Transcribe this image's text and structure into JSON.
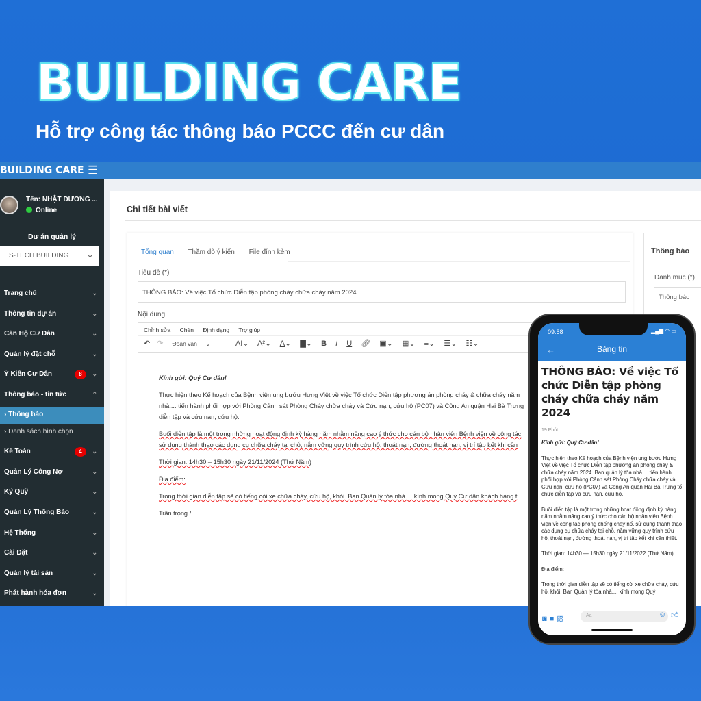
{
  "hero": {
    "title": "BUILDING CARE",
    "subtitle": "Hỗ trợ công tác thông báo PCCC đến cư dân"
  },
  "colors": {
    "background": "#1f6fd6",
    "topbar": "#2f7fcd",
    "sidebar": "#222d32",
    "active": "#3c8dbc",
    "badge": "#e60000"
  },
  "app": {
    "brand": "BUILDING CARE",
    "menu_icon": "hamburger-icon"
  },
  "user": {
    "name": "Tên: NHẬT DƯƠNG ...",
    "status": "Online"
  },
  "project": {
    "label": "Dự án quản lý",
    "selected": "S-TECH BUILDING"
  },
  "sidebar": {
    "items": [
      {
        "label": "Trang chủ"
      },
      {
        "label": "Thông tin dự án"
      },
      {
        "label": "Căn Hộ Cư Dân"
      },
      {
        "label": "Quản lý đặt chỗ"
      },
      {
        "label": "Ý Kiến Cư Dân",
        "badge": "8"
      },
      {
        "label": "Thông báo - tin tức"
      },
      {
        "label": "Thông báo"
      },
      {
        "label": "Danh sách bình chọn"
      },
      {
        "label": "Kế Toán",
        "badge": "4"
      },
      {
        "label": "Quản Lý Công Nợ"
      },
      {
        "label": "Ký Quỹ"
      },
      {
        "label": "Quản Lý Thông Báo"
      },
      {
        "label": "Hệ Thống"
      },
      {
        "label": "Cài Đặt"
      },
      {
        "label": "Quản lý tài sản"
      },
      {
        "label": "Phát hành hóa đơn"
      }
    ]
  },
  "main": {
    "title": "Chi tiết bài viết",
    "tabs": [
      "Tổng quan",
      "Thăm dò ý kiến",
      "File đính kèm"
    ],
    "title_label": "Tiêu đề (*)",
    "title_value": "THÔNG BÁO: Về việc Tổ chức Diễn tập phòng cháy chữa cháy năm 2024",
    "content_label": "Nội dung",
    "editor_menu": [
      "Chỉnh sửa",
      "Chèn",
      "Định dạng",
      "Trợ giúp"
    ],
    "paragraph_style": "Đoạn văn",
    "content": [
      "Kính gửi: Quý Cư dân!",
      "Thực hiện theo Kế hoạch của Bệnh viện ung bướu Hưng Việt về việc Tổ chức Diễn tập phương án phòng cháy & chữa cháy năm",
      "nhà.... tiến hành phối hợp với Phòng Cảnh sát Phòng Cháy chữa cháy và Cứu nạn, cứu hộ (PC07) và Công An quận Hai Bà Trưng",
      "diễn tập và cứu nạn, cứu hộ.",
      "Buổi diễn tập là một trong những hoạt động định kỳ hàng năm nhằm nâng cao ý thức cho cán bộ nhân viên Bệnh viện về công tác",
      "sử dụng thành thạo các dụng cụ chữa cháy tại chỗ, nắm vững quy trình cứu hộ, thoát nạn, đường thoát nạn, vị trí tập kết khi cần",
      "Thời gian: 14h30 – 15h30 ngày 21/11/2024 (Thứ Năm)",
      "Địa điểm:",
      "Trong thời gian diễn tập sẽ có tiếng còi xe chữa cháy, cứu hộ, khói. Ban Quản lý tòa nhà.... kính mong Quý Cư dân khách hàng t",
      "Trân trọng./."
    ]
  },
  "right_panel": {
    "title": "Thông báo",
    "category_label": "Danh mục (*)",
    "category_value": "Thông báo"
  },
  "phone": {
    "time": "09:58",
    "header": "Bảng tin",
    "title": "THÔNG BÁO: Về việc Tổ chức Diễn tập phòng cháy chữa cháy năm 2024",
    "meta": "19 Phút",
    "greeting": "Kính gửi: Quý Cư dân!",
    "p1": "Thực hiện theo Kế hoạch của Bệnh viện ung bướu Hưng Việt về việc Tổ chức Diễn tập phương án phòng cháy & chữa cháy năm 2024. Ban quản lý tòa nhà.... tiến hành phối hợp với Phòng Cảnh sát Phòng Cháy chữa cháy và Cứu nạn, cứu hộ (PC07) và Công An quận Hai Bà Trưng tổ chức diễn tập và cứu nạn, cứu hộ.",
    "p2": "Buổi diễn tập là một trong những hoạt động định kỳ hàng năm nhằm nâng cao ý thức cho cán bộ nhân viên Bệnh viện về công tác phòng chống cháy nổ, sử dụng thành thạo các dụng cụ chữa cháy tại chỗ, nắm vững quy trình cứu hộ, thoát nạn, đường thoát nạn, vị trí tập kết khi cần thiết.",
    "p3": "Thời gian: 14h30 — 15h30 ngày 21/11/2022 (Thứ Năm)",
    "p4": "Địa điểm:",
    "p5": "Trong thời gian diễn tập sẽ có tiếng còi xe chữa cháy, cứu hộ, khói. Ban Quản lý tòa nhà.... kính mong Quý",
    "input_placeholder": "Aa"
  }
}
